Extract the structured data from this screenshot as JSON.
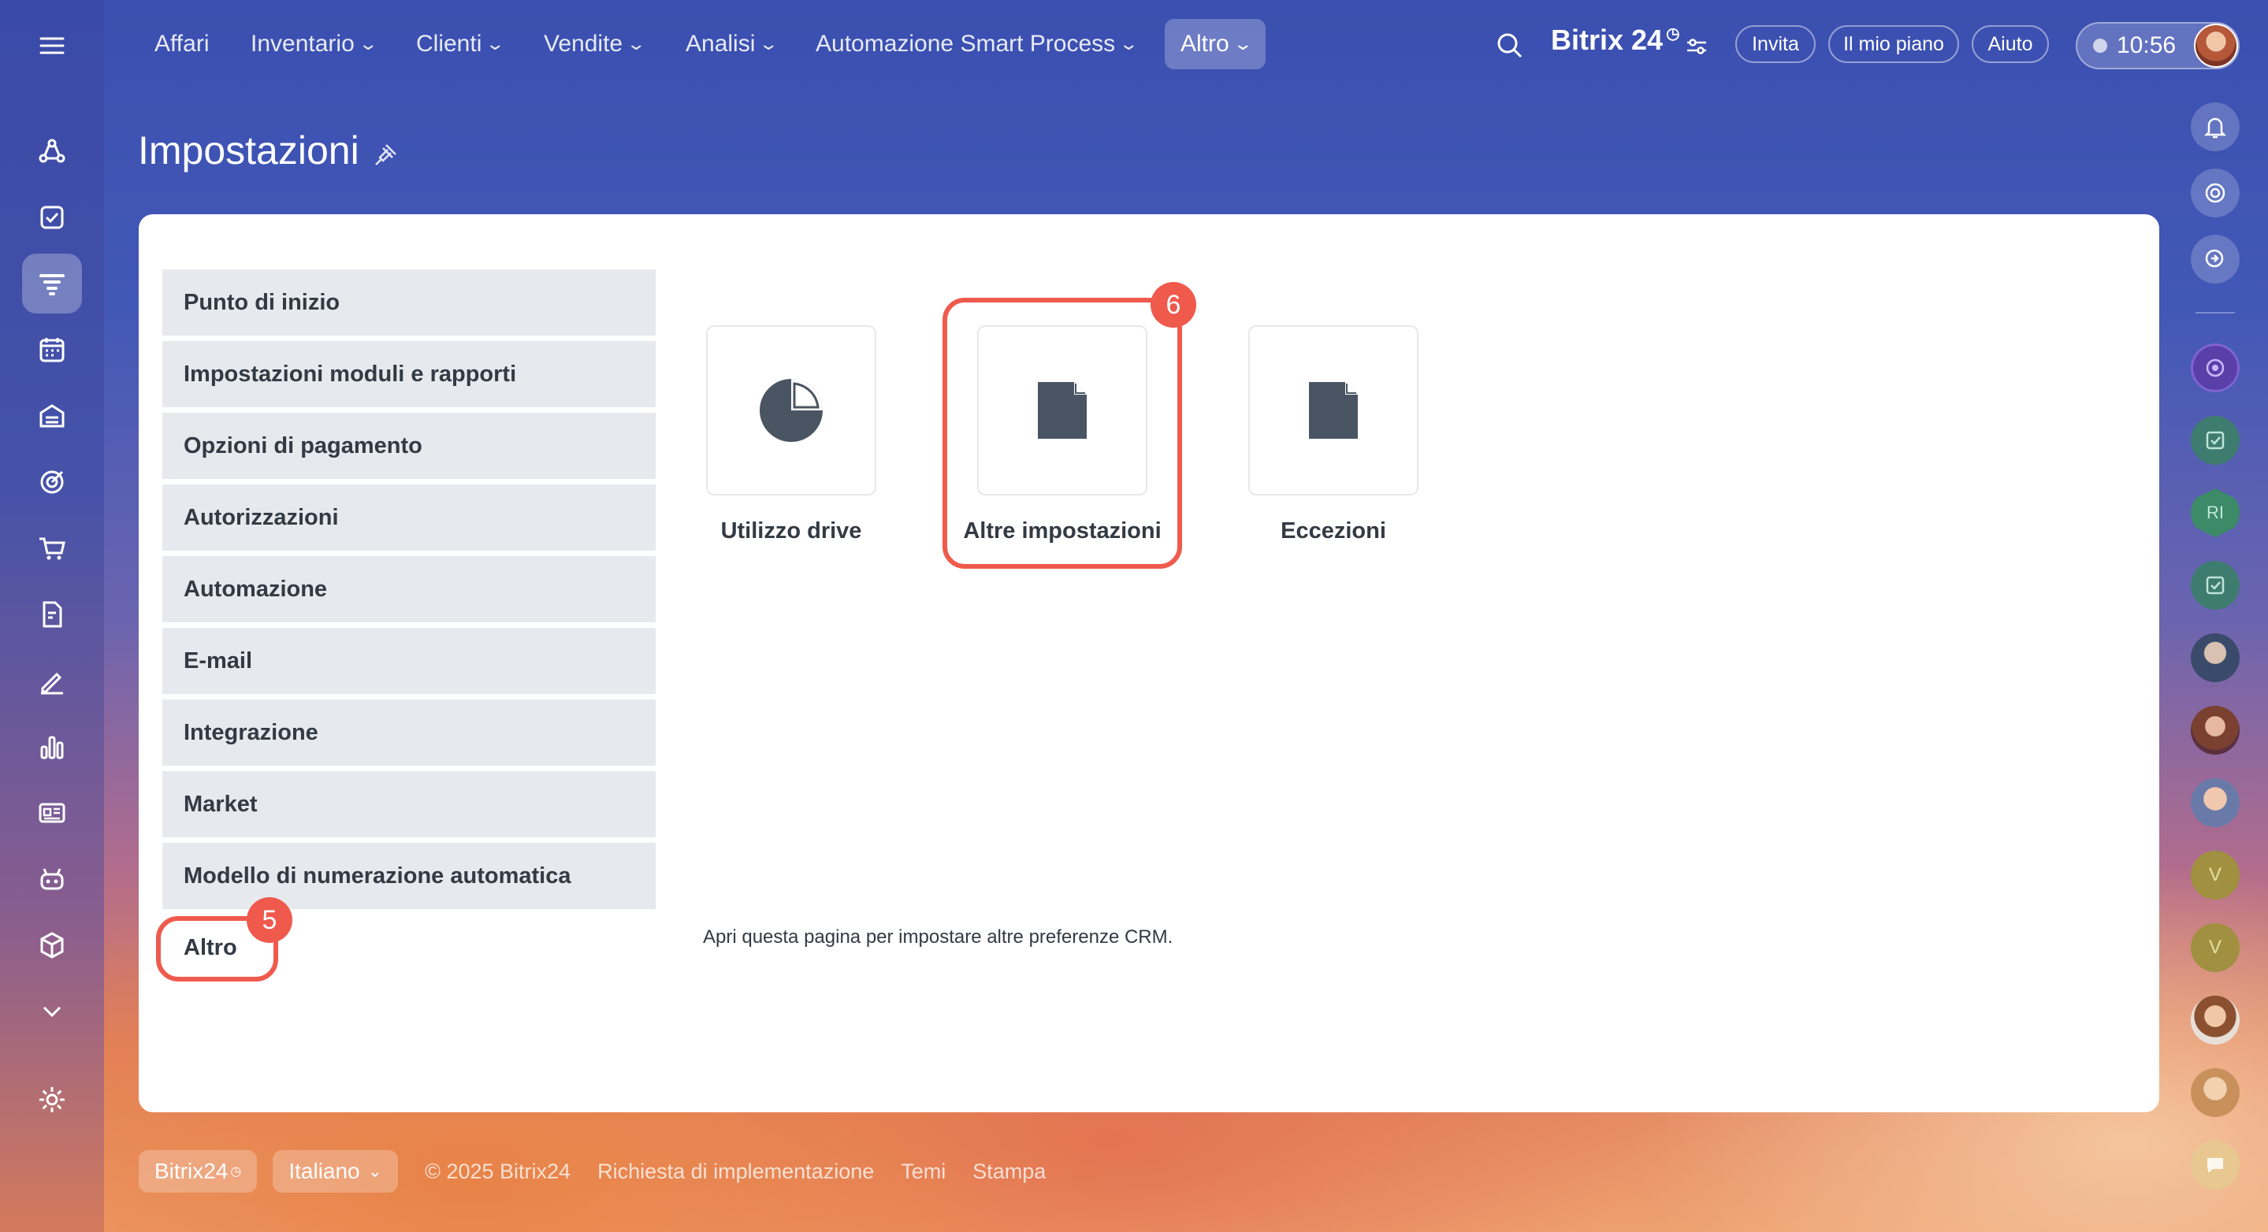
{
  "nav": {
    "items": [
      {
        "label": "Affari",
        "dropdown": false
      },
      {
        "label": "Inventario",
        "dropdown": true
      },
      {
        "label": "Clienti",
        "dropdown": true
      },
      {
        "label": "Vendite",
        "dropdown": true
      },
      {
        "label": "Analisi",
        "dropdown": true
      },
      {
        "label": "Automazione Smart Process",
        "dropdown": true
      },
      {
        "label": "Altro",
        "dropdown": true
      }
    ],
    "brand": "Bitrix 24",
    "invite": "Invita",
    "plan": "Il mio piano",
    "help": "Aiuto",
    "time": "10:56"
  },
  "page": {
    "title": "Impostazioni"
  },
  "menu": [
    "Punto di inizio",
    "Impostazioni moduli e rapporti",
    "Opzioni di pagamento",
    "Autorizzazioni",
    "Automazione",
    "E-mail",
    "Integrazione",
    "Market",
    "Modello di numerazione automatica",
    "Altro"
  ],
  "tiles": [
    {
      "label": "Utilizzo drive",
      "icon": "pie-chart-icon"
    },
    {
      "label": "Altre impostazioni",
      "icon": "document-icon"
    },
    {
      "label": "Eccezioni",
      "icon": "document-icon"
    }
  ],
  "description": "Apri questa pagina per impostare altre preferenze CRM.",
  "badges": {
    "menu": "5",
    "tile": "6"
  },
  "rightbar": {
    "initials1": "RI",
    "initials2": "V",
    "initials3": "V"
  },
  "footer": {
    "brand": "Bitrix24",
    "language": "Italiano",
    "copyright": "© 2025 Bitrix24",
    "links": [
      "Richiesta di implementazione",
      "Temi",
      "Stampa"
    ]
  },
  "colors": {
    "accent": "#ef5a4d",
    "menu_bg": "#e6e9ed",
    "text": "#333a44"
  }
}
